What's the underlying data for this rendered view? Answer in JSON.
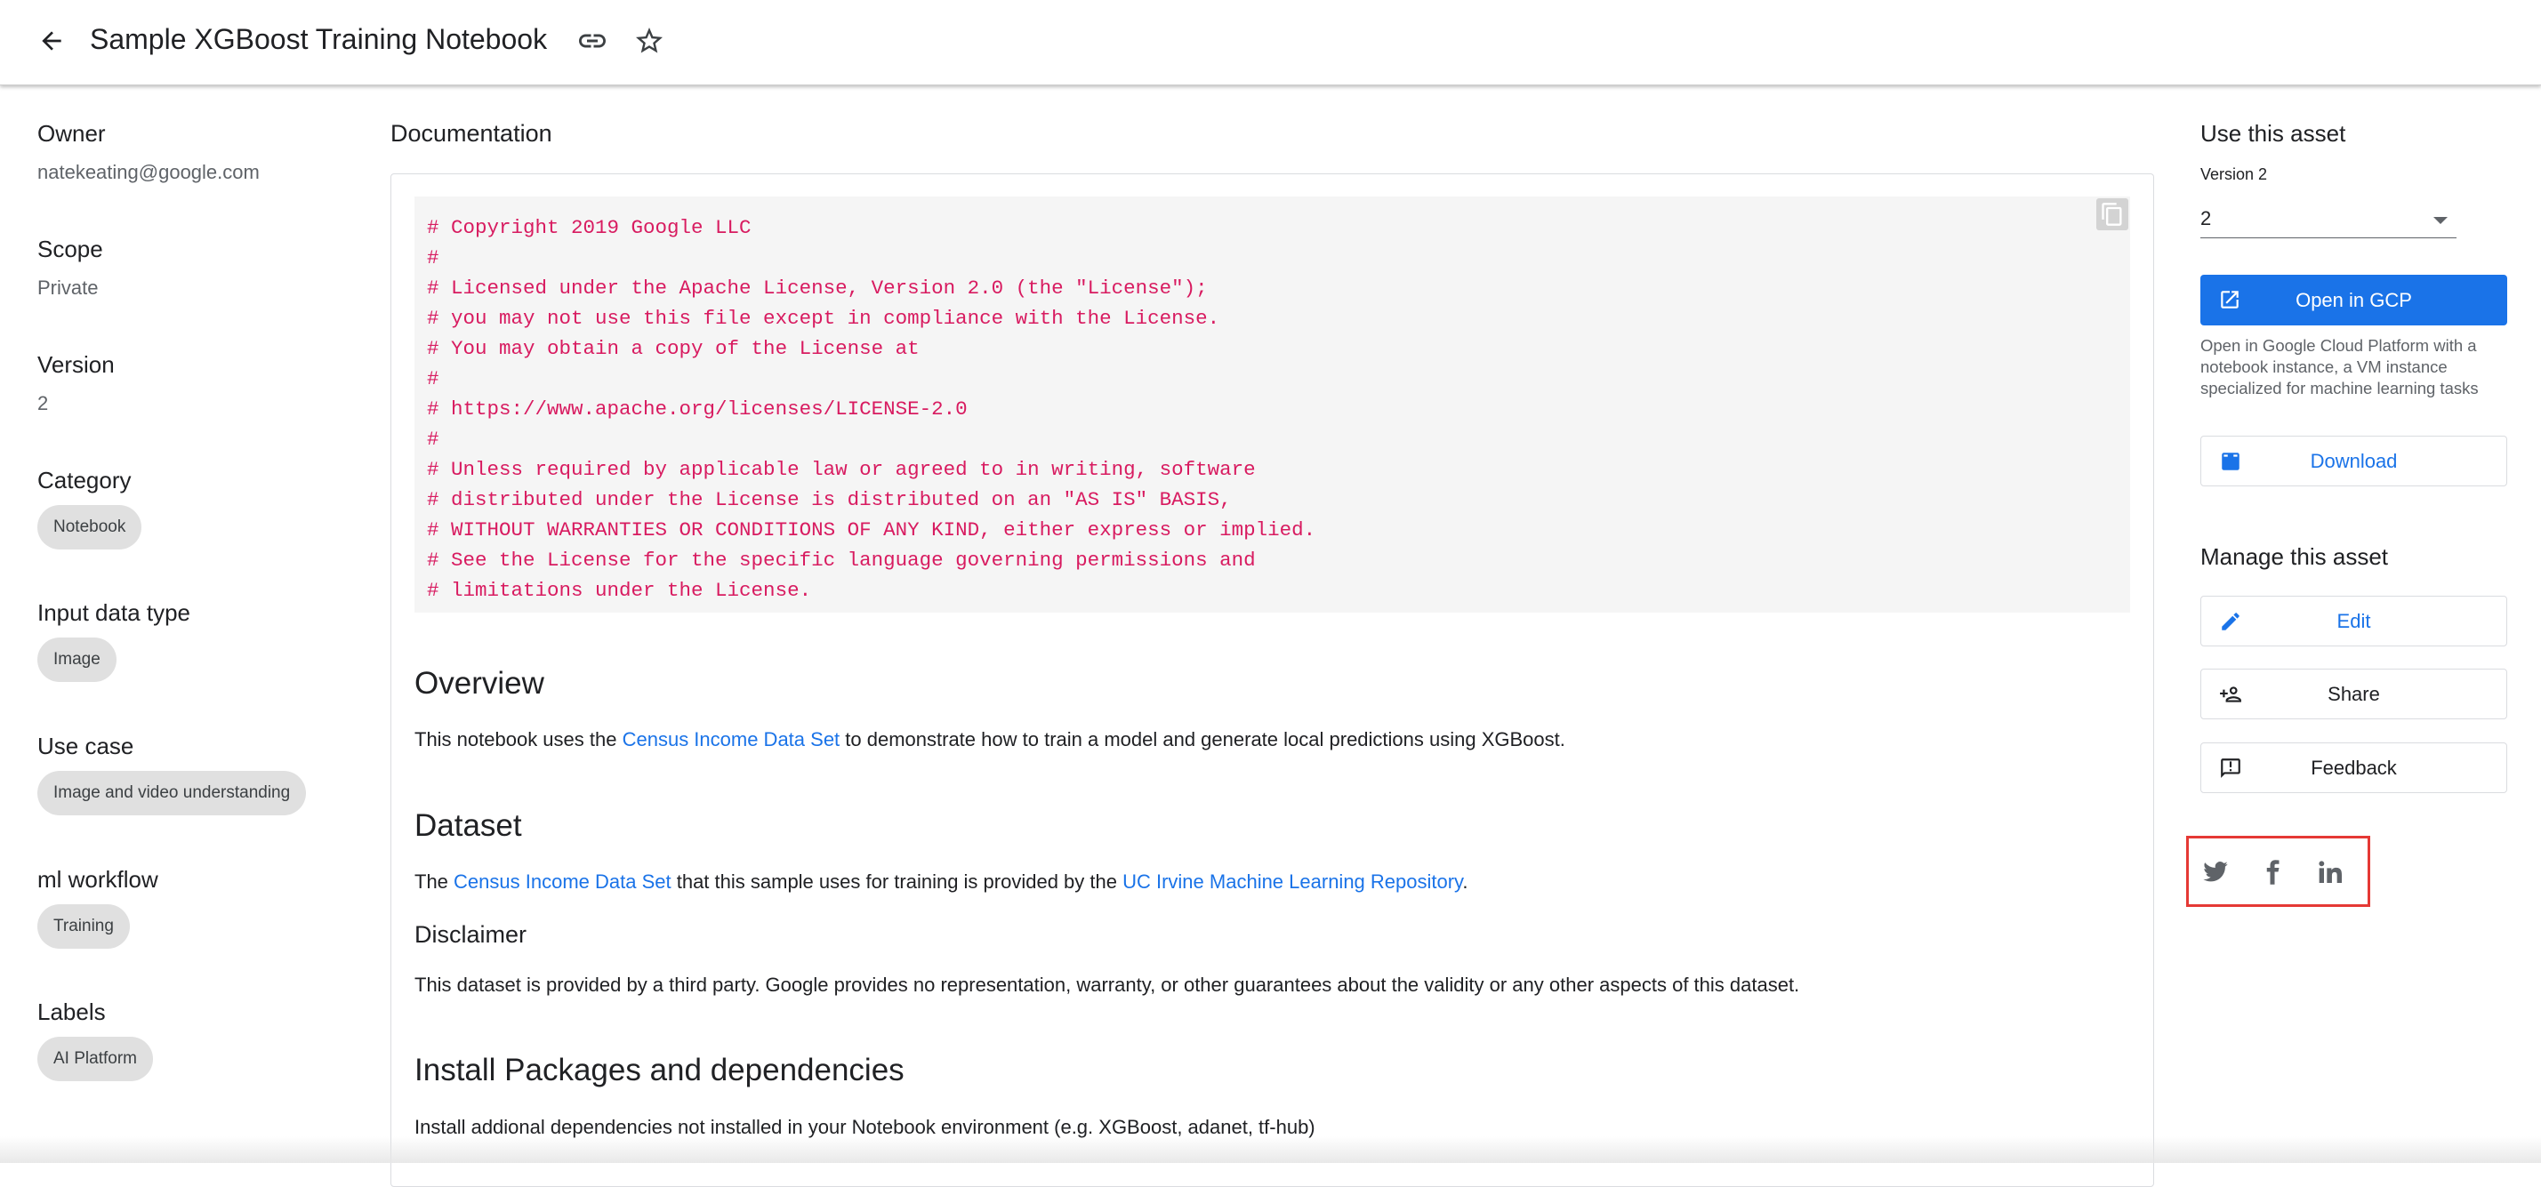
{
  "header": {
    "title": "Sample XGBoost Training Notebook",
    "back_icon": "arrow-back-icon",
    "link_icon": "link-icon",
    "star_icon": "star-outline-icon"
  },
  "sidebar": {
    "owner": {
      "label": "Owner",
      "value": "natekeating@google.com"
    },
    "scope": {
      "label": "Scope",
      "value": "Private"
    },
    "version": {
      "label": "Version",
      "value": "2"
    },
    "category": {
      "label": "Category",
      "chip": "Notebook"
    },
    "input_data_type": {
      "label": "Input data type",
      "chip": "Image"
    },
    "use_case": {
      "label": "Use case",
      "chip": "Image and video understanding"
    },
    "ml_workflow": {
      "label": "ml workflow",
      "chip": "Training"
    },
    "labels": {
      "label": "Labels",
      "chip": "AI Platform"
    }
  },
  "documentation": {
    "heading": "Documentation",
    "code_lines": [
      "# Copyright 2019 Google LLC",
      "#",
      "# Licensed under the Apache License, Version 2.0 (the \"License\");",
      "# you may not use this file except in compliance with the License.",
      "# You may obtain a copy of the License at",
      "#",
      "# https://www.apache.org/licenses/LICENSE-2.0",
      "#",
      "# Unless required by applicable law or agreed to in writing, software",
      "# distributed under the License is distributed on an \"AS IS\" BASIS,",
      "# WITHOUT WARRANTIES OR CONDITIONS OF ANY KIND, either express or implied.",
      "# See the License for the specific language governing permissions and",
      "# limitations under the License."
    ],
    "overview": {
      "title": "Overview",
      "text_before": "This notebook uses the ",
      "link": "Census Income Data Set",
      "text_after": " to demonstrate how to train a model and generate local predictions using XGBoost."
    },
    "dataset": {
      "title": "Dataset",
      "text_1": "The ",
      "link_1": "Census Income Data Set",
      "text_2": " that this sample uses for training is provided by the ",
      "link_2": "UC Irvine Machine Learning Repository",
      "text_3": "."
    },
    "disclaimer": {
      "title": "Disclaimer",
      "text": "This dataset is provided by a third party. Google provides no representation, warranty, or other guarantees about the validity or any other aspects of this dataset."
    },
    "install": {
      "title": "Install Packages and dependencies",
      "text": "Install addional dependencies not installed in your Notebook environment (e.g. XGBoost, adanet, tf-hub)"
    }
  },
  "right_panel": {
    "use_heading": "Use this asset",
    "version_label": "Version 2",
    "version_selected": "2",
    "open_gcp_label": "Open in GCP",
    "open_gcp_desc": "Open in Google Cloud Platform with a notebook instance, a VM instance specialized for machine learning tasks",
    "download_label": "Download",
    "manage_heading": "Manage this asset",
    "edit_label": "Edit",
    "share_label": "Share",
    "feedback_label": "Feedback",
    "social": [
      "twitter-icon",
      "facebook-icon",
      "linkedin-icon"
    ]
  },
  "colors": {
    "accent": "#1a73e8",
    "code_text": "#d81b60",
    "highlight_box": "#e53935"
  }
}
